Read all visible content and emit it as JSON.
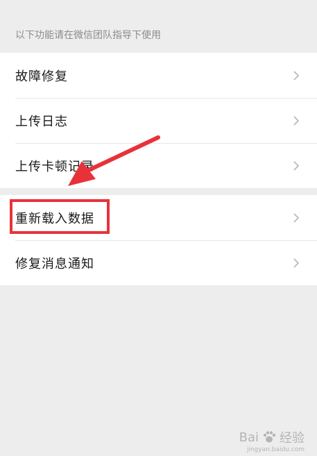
{
  "section_hint": "以下功能请在微信团队指导下使用",
  "group1": [
    {
      "label": "故障修复"
    },
    {
      "label": "上传日志"
    },
    {
      "label": "上传卡顿记录"
    }
  ],
  "group2": [
    {
      "label": "重新载入数据"
    },
    {
      "label": "修复消息通知"
    }
  ],
  "watermark": {
    "brand": "Bai",
    "brand2": "经验",
    "sub": "jingyan.baidu.com"
  },
  "colors": {
    "highlight": "#e8323a",
    "background": "#ededed",
    "hint_text": "#8c8c8c"
  }
}
